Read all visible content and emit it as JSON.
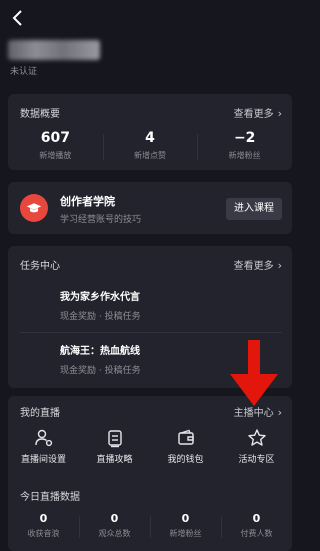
{
  "header": {
    "back_icon": "chevron-left-icon"
  },
  "profile": {
    "verify_status": "未认证"
  },
  "data_overview": {
    "title": "数据概要",
    "more": "查看更多",
    "stats": [
      {
        "value": "607",
        "label": "新增播放"
      },
      {
        "value": "4",
        "label": "新增点赞"
      },
      {
        "value": "−2",
        "label": "新增粉丝"
      }
    ]
  },
  "creator_school": {
    "icon": "graduation-cap-icon",
    "accent": "#e8473e",
    "title": "创作者学院",
    "subtitle": "学习经营账号的技巧",
    "button": "进入课程"
  },
  "task_center": {
    "title": "任务中心",
    "more": "查看更多",
    "tasks": [
      {
        "title": "我为家乡作水代言",
        "subtitle": "现金奖励 · 投稿任务"
      },
      {
        "title": "航海王：热血航线",
        "subtitle": "现金奖励 · 投稿任务"
      }
    ]
  },
  "my_live": {
    "title": "我的直播",
    "more": "主播中心",
    "actions": [
      {
        "label": "直播间设置",
        "icon": "user-settings-icon"
      },
      {
        "label": "直播攻略",
        "icon": "tv-guide-icon"
      },
      {
        "label": "我的钱包",
        "icon": "wallet-icon"
      },
      {
        "label": "活动专区",
        "icon": "star-icon"
      }
    ],
    "today_title": "今日直播数据",
    "today_stats": [
      {
        "value": "0",
        "label": "收获音浪"
      },
      {
        "value": "0",
        "label": "观众总数"
      },
      {
        "value": "0",
        "label": "新增粉丝"
      },
      {
        "value": "0",
        "label": "付费人数"
      }
    ]
  },
  "annotation": {
    "arrow_color": "#e3160b",
    "arrow_icon": "arrow-down-icon"
  }
}
